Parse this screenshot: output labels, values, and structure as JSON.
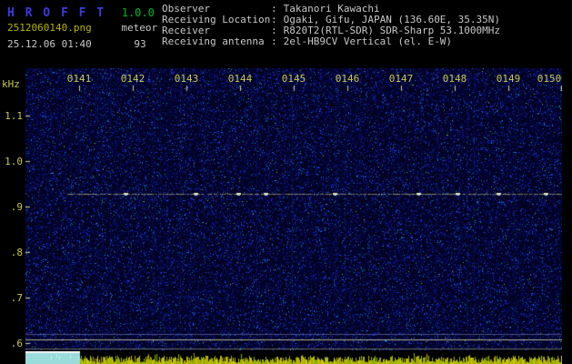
{
  "app": {
    "title": "H R O F F T",
    "version": "1.0.0",
    "filename": "2512060140.png",
    "mode": "meteor",
    "datetime": "25.12.06 01:40",
    "count": "93"
  },
  "info": {
    "separator": ":",
    "rows": [
      {
        "label": "Observer",
        "value": "Takanori Kawachi"
      },
      {
        "label": "Receiving Location",
        "value": "Ogaki, Gifu, JAPAN (136.60E, 35.35N)"
      },
      {
        "label": "Receiver",
        "value": "R820T2(RTL-SDR) SDR-Sharp 53.1000MHz"
      },
      {
        "label": "Receiving antenna",
        "value": "2el-HB9CV Vertical (el. E-W)"
      }
    ]
  },
  "chart_data": {
    "type": "heatmap",
    "title": "Radio meteor observation spectrogram, 10-minute window ending 01:50",
    "x_axis": {
      "start": "0140",
      "end": "0150",
      "ticks": [
        "0141",
        "0142",
        "0143",
        "0144",
        "0145",
        "0146",
        "0147",
        "0148",
        "0149",
        "0150"
      ],
      "units": "hhmm local time"
    },
    "y_axis": {
      "label": "kHz",
      "ticks": [
        "1.1",
        "1.0",
        ".9",
        ".8",
        ".7",
        ".6"
      ],
      "tick_values_khz": [
        1.1,
        1.0,
        0.9,
        0.8,
        0.7,
        0.6
      ]
    },
    "features": {
      "background": "random dark-blue noise",
      "carrier_line_khz": 0.93,
      "carrier_line_span": "0141 to 0150",
      "bright_echo_spots_approx_minutes": [
        "0143",
        "0144",
        "0145",
        "0147",
        "0149"
      ],
      "interference_lines_khz": [
        0.63,
        0.62,
        0.6
      ]
    },
    "level_strip": {
      "description": "signal-level bar strip along bottom edge",
      "saturated_region": "0140 to 0141"
    },
    "legend": "none",
    "grid": false
  },
  "colors": {
    "title_blue": "#3a3ae0",
    "version_green": "#00b428",
    "filename_yellow": "#b4b400",
    "text_gray": "#c8c8c8",
    "axis_tick_yellow": "#c8c850",
    "noise_base_blue": "#000030",
    "carrier_line": "#d2d296",
    "level_bar_yellow": "#b4b400",
    "level_box_cyan": "#9adcdc"
  }
}
